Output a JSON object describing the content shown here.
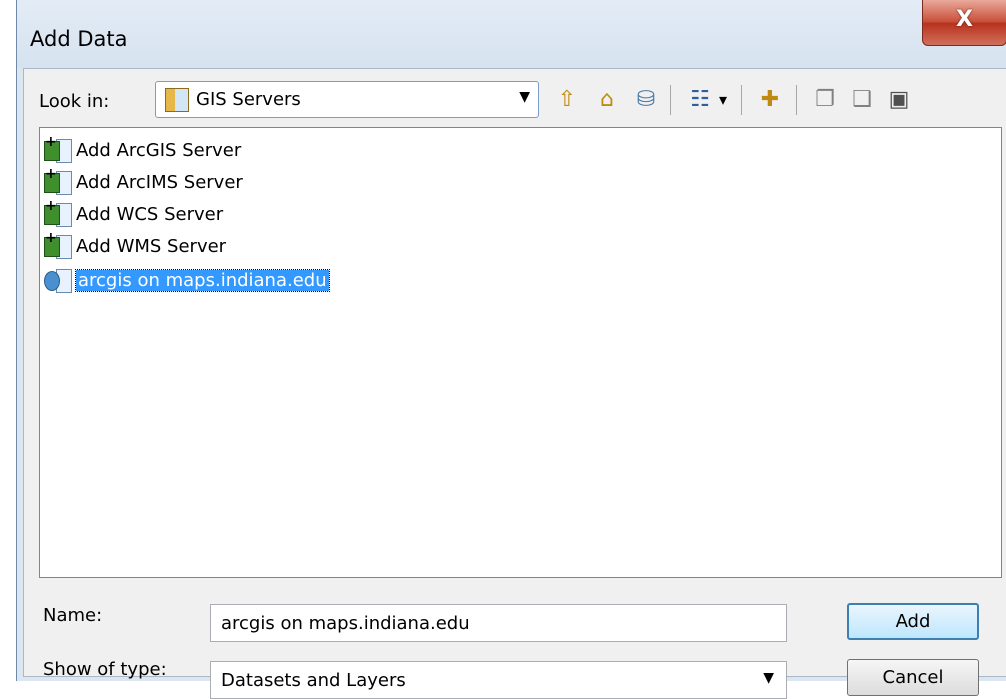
{
  "window": {
    "title": "Add Data",
    "close_label": "X"
  },
  "lookin": {
    "label": "Look in:",
    "value": "GIS Servers"
  },
  "toolbar": [
    {
      "name": "up-one-level-icon",
      "glyph": "⇧",
      "color": "#c08a10"
    },
    {
      "name": "home-icon",
      "glyph": "⌂",
      "color": "#c08a10"
    },
    {
      "name": "connect-database-icon",
      "glyph": "⛁",
      "color": "#4a78a8"
    },
    {
      "name": "view-list-icon",
      "glyph": "☷",
      "color": "#2e5e9e"
    },
    {
      "name": "view-dropdown-icon",
      "glyph": "▾",
      "color": "#000000"
    },
    {
      "name": "new-folder-icon",
      "glyph": "✚",
      "color": "#c08a10"
    },
    {
      "name": "new-file-icon",
      "glyph": "❐",
      "color": "#808080"
    },
    {
      "name": "new-database-icon",
      "glyph": "❑",
      "color": "#808080"
    },
    {
      "name": "toolbox-icon",
      "glyph": "▣",
      "color": "#505050"
    }
  ],
  "files": [
    {
      "label": "Add ArcGIS Server",
      "icon": "add-server-icon",
      "selected": false
    },
    {
      "label": "Add ArcIMS Server",
      "icon": "add-server-icon",
      "selected": false
    },
    {
      "label": "Add WCS Server",
      "icon": "add-server-icon",
      "selected": false
    },
    {
      "label": "Add WMS Server",
      "icon": "add-server-icon",
      "selected": false
    },
    {
      "label": "arcgis on maps.indiana.edu",
      "icon": "server-connection-icon",
      "selected": true
    }
  ],
  "name": {
    "label": "Name:",
    "value": "arcgis on maps.indiana.edu"
  },
  "type": {
    "label": "Show of type:",
    "value": "Datasets and Layers"
  },
  "buttons": {
    "add": "Add",
    "cancel": "Cancel"
  }
}
